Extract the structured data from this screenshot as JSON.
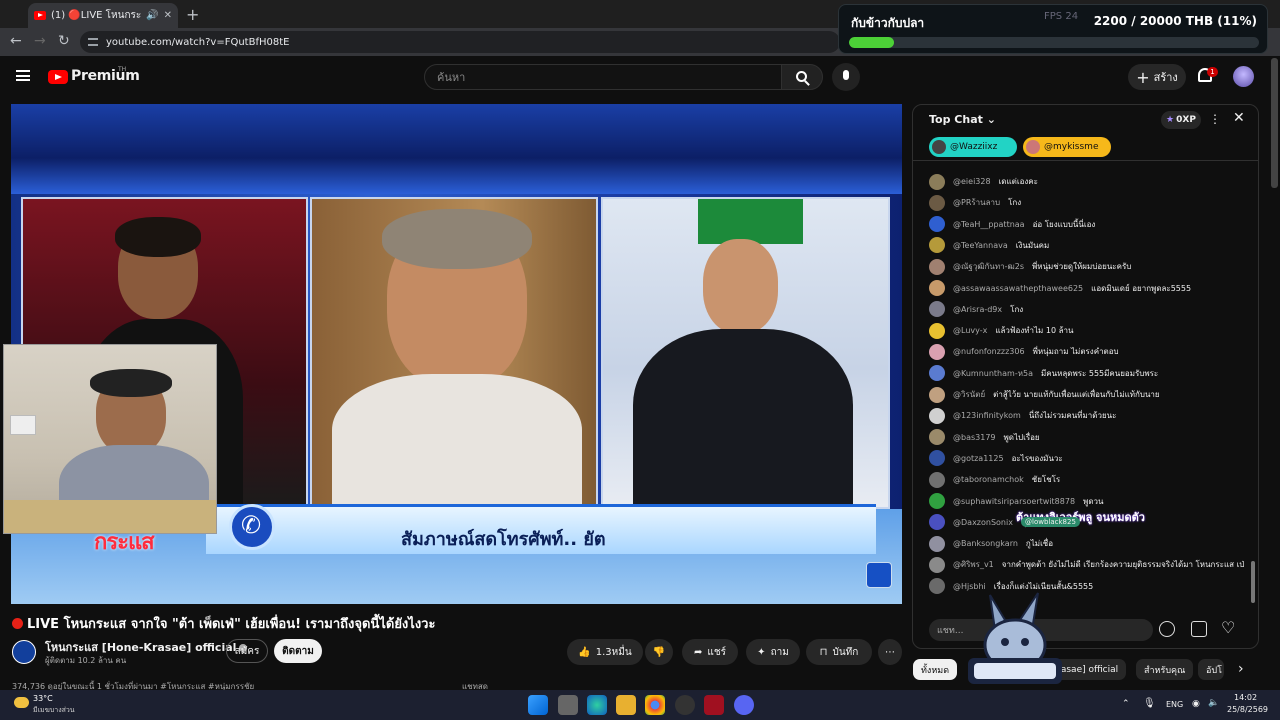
{
  "browser": {
    "tab_title": "(1) 🔴LIVE โหนกระแส จากใจ",
    "url": "youtube.com/watch?v=FQutBfH08tE"
  },
  "donation": {
    "title": "กับข้าวกับปลา",
    "amount": "2200 / 20000 THB (11%)",
    "progress": 0.11,
    "fps_label": "FPS",
    "fps_value": "24"
  },
  "header": {
    "brand": "Premium",
    "brand_suffix": "TH",
    "search_placeholder": "ค้นหา",
    "create_label": "สร้าง",
    "notification_count": "1"
  },
  "video": {
    "overlay_caption": "สัมภาษณ์สดโทรศัพท์.. ยัต",
    "overlay_logo": "กระแส",
    "title": "LIVE โหนกระแส จากใจ \"ต้า เพ็ดเฟ่\" เฮ้ยเพื่อน! เรามาถึงจุดนี้ได้ยังไงวะ",
    "channel": "โหนกระแส [Hone-Krasae] official",
    "subscribers": "ผู้ติดตาม 10.2 ล้าน คน",
    "join_label": "สมัคร",
    "subscribe_label": "ติดตาม",
    "likes": "1.3หมื่น",
    "share_label": "แชร์",
    "ask_label": "ถาม",
    "save_label": "บันทึก",
    "desc_peek": "374,736 ดูอยู่ในขณะนี้ 1 ชั่วโมงที่ผ่านมา #โหนกระแส #หนุ่มกรรชัย",
    "comments_peek": "แชทสด"
  },
  "chat": {
    "mode": "Top Chat",
    "xp": "0XP",
    "pinned": [
      "@Wazziixz",
      "@mykissme"
    ],
    "input_placeholder": "แชท...",
    "messages": [
      {
        "user": "@eiei328",
        "text": "เดแต่เองคะ",
        "color": "#8b7d5a"
      },
      {
        "user": "@PRร้านลาบ",
        "text": "โกง",
        "color": "#6b5a44"
      },
      {
        "user": "@TeaH__ppattnaa",
        "text": "อ่อ โยงแบบนี้นี่เอง",
        "color": "#2f5fd0"
      },
      {
        "user": "@TeeYannava",
        "text": "เงินมันคม",
        "color": "#b59a3a"
      },
      {
        "user": "@ณัฐวุฒิกันทา-ฒ2s",
        "text": "พี่หนุ่มช่วยดูให้ผมบ่อยนะครับ",
        "color": "#a08070"
      },
      {
        "user": "@assawaassawathepthawee625",
        "text": "แอดมินเดย์ อยากพูดละ5555",
        "color": "#c79a6a"
      },
      {
        "user": "@Arisra-d9x",
        "text": "โกง",
        "color": "#7a7a8a"
      },
      {
        "user": "@Luvy-x",
        "text": "แล้วฟ้องทำไม 10 ล้าน",
        "color": "#e8c030"
      },
      {
        "user": "@nufonfonzzz306",
        "text": "พี่หนุ่มถาม ไม่ตรงคำตอบ",
        "color": "#d9a0b0"
      },
      {
        "user": "@Kumnuntham-ห5a",
        "text": "มีคนหลุดพระ 555มีคนยอมรับพระ",
        "color": "#5a7bd0"
      },
      {
        "user": "@วิรนัตย์",
        "text": "ต่าสู้ไว้ย นายแท้กับเพื่อนแต่เพื่อนกับไม่แท้กับนาย",
        "color": "#c0a080"
      },
      {
        "user": "@123infinitykom",
        "text": "นี่ถึงไม่รวมคนที่มาด้วยนะ",
        "color": "#d0d0d0"
      },
      {
        "user": "@bas3179",
        "text": "พูดไปเรื่อย",
        "color": "#9a8a6a"
      },
      {
        "user": "@gotza1125",
        "text": "อะไรของมันวะ",
        "color": "#3050a0"
      },
      {
        "user": "@taboronamchok",
        "text": "ชัยโชโร",
        "color": "#707070"
      },
      {
        "user": "@suphawitsiriparsoertwit8878",
        "text": "พูดวน",
        "color": "#30a040"
      },
      {
        "user": "@DaxzonSonix",
        "text": "ทุนเพื่อน",
        "color": "#4a50c0"
      },
      {
        "user": "@Banksongkarn",
        "text": "กูไม่เชื่อ",
        "color": "#9090a0"
      },
      {
        "user": "@ศิริพร_v1",
        "text": "จากคำพูดต้า ยังไม่ไม่ดี เรียกร้องความยุติธรรมจริงได้มา โหนกระแส เป่า",
        "color": "#8a8a8a"
      },
      {
        "user": "@Hjsbhi",
        "text": "เรื่องก็แต่งไม่เนียนสั้น&5555",
        "color": "#6a6a6a"
      }
    ],
    "sticker_text": "ต้าแทงลิเวอร์พลู จนหมดตัว",
    "sticker_user": "@lowblack825"
  },
  "chips": [
    "ทั้งหมด",
    "-Krasae] official",
    "สำหรับคุณ",
    "อัปโ"
  ],
  "taskbar": {
    "temp": "33°C",
    "weather": "มีเมฆบางส่วน",
    "lang": "ENG",
    "time": "14:02",
    "date": "25/8/2569"
  }
}
